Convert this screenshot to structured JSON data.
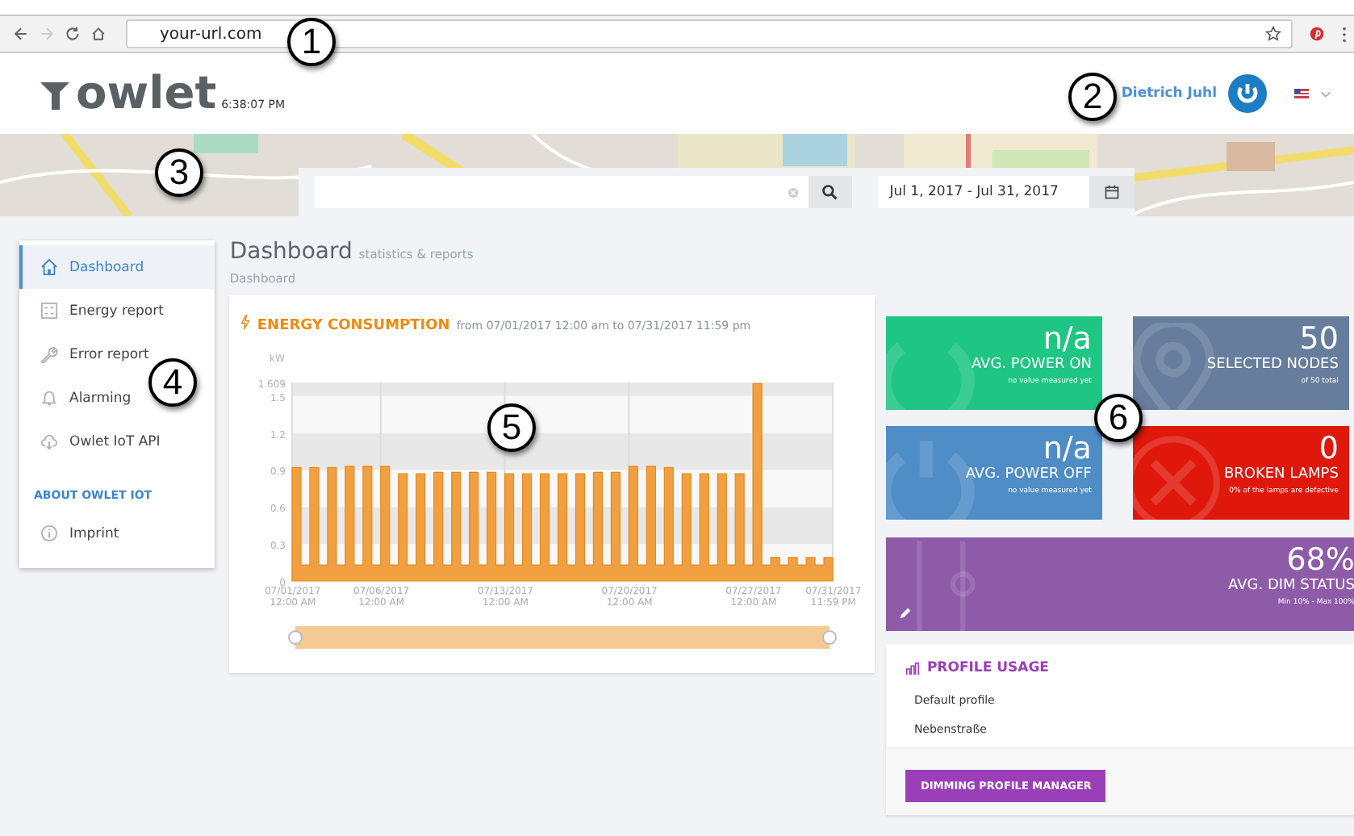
{
  "browser": {
    "url": "your-url.com"
  },
  "header": {
    "logo": "owlet",
    "time": "6:38:07 PM",
    "user": "Dietrich Juhl"
  },
  "search": {
    "date_range": "Jul 1, 2017 - Jul 31, 2017"
  },
  "sidebar": {
    "items": [
      {
        "label": "Dashboard",
        "kind": "home",
        "selected": true
      },
      {
        "label": "Energy report",
        "kind": "calculator",
        "selected": false
      },
      {
        "label": "Error report",
        "kind": "wrench",
        "selected": false
      },
      {
        "label": "Alarming",
        "kind": "bell",
        "selected": false
      },
      {
        "label": "Owlet IoT API",
        "kind": "cloud",
        "selected": false
      }
    ],
    "section": "ABOUT OWLET IOT",
    "footer_items": [
      {
        "label": "Imprint",
        "kind": "info",
        "selected": false
      }
    ]
  },
  "page": {
    "title": "Dashboard",
    "subtitle": "statistics & reports",
    "breadcrumb": "Dashboard"
  },
  "energy": {
    "title": "ENERGY CONSUMPTION",
    "range": "from 07/01/2017 12:00 am to 07/31/2017 11:59 pm",
    "chart_data": {
      "type": "area",
      "grid": true,
      "ylabel": "kW",
      "ylim": [
        0,
        1.609
      ],
      "categories": [
        "07/01/2017 12:00 AM",
        null,
        null,
        null,
        null,
        null,
        null,
        null,
        null,
        null,
        "07/06/2017 12:00 AM",
        null,
        null,
        null,
        null,
        null,
        null,
        null,
        null,
        null,
        null,
        null,
        null,
        null,
        "07/13/2017 12:00 AM",
        null,
        null,
        null,
        null,
        null,
        null,
        null,
        null,
        null,
        null,
        null,
        null,
        null,
        "07/20/2017 12:00 AM",
        null,
        null,
        null,
        null,
        null,
        null,
        null,
        null,
        null,
        null,
        null,
        null,
        null,
        "07/27/2017 12:00 AM",
        null,
        null,
        null,
        null,
        null,
        null,
        null,
        null,
        "07/31/2017 11:59 PM"
      ],
      "yticks": [
        0,
        0.3,
        0.6,
        0.9,
        1.2,
        1.5,
        {
          "value": 1.609,
          "label": "1.609"
        }
      ],
      "series": [
        {
          "color": "#f0a040",
          "values": [
            0.92,
            0.13,
            0.92,
            0.13,
            0.92,
            0.13,
            0.93,
            0.13,
            0.93,
            0.13,
            0.93,
            0.13,
            0.87,
            0.13,
            0.87,
            0.13,
            0.88,
            0.13,
            0.88,
            0.13,
            0.88,
            0.13,
            0.88,
            0.13,
            0.87,
            0.13,
            0.87,
            0.13,
            0.87,
            0.13,
            0.87,
            0.13,
            0.87,
            0.13,
            0.88,
            0.13,
            0.88,
            0.13,
            0.93,
            0.13,
            0.93,
            0.13,
            0.92,
            0.13,
            0.87,
            0.13,
            0.87,
            0.13,
            0.87,
            0.13,
            0.87,
            0.13,
            1.6,
            0.13,
            0.19,
            0.13,
            0.19,
            0.13,
            0.19,
            0.13,
            0.19,
            0.13
          ]
        }
      ]
    }
  },
  "tiles": [
    {
      "kind": "power_on",
      "value": "n/a",
      "label": "AVG. POWER ON",
      "note": "no value measured yet",
      "color": "#1ec583"
    },
    {
      "kind": "nodes",
      "value": "50",
      "label": "SELECTED NODES",
      "note": "of 50 total",
      "color": "#677d9d"
    },
    {
      "kind": "power_off",
      "value": "n/a",
      "label": "AVG. POWER OFF",
      "note": "no value measured yet",
      "color": "#4f8dc6"
    },
    {
      "kind": "broken",
      "value": "0",
      "label": "BROKEN LAMPS",
      "note": "0% of the lamps are defective",
      "color": "#e0180c"
    },
    {
      "kind": "dim",
      "value": "68%",
      "label": "AVG. DIM STATUS",
      "note": "Min 10% - Max 100%",
      "color": "#8e5ba8"
    }
  ],
  "profile_usage": {
    "title": "PROFILE USAGE",
    "items": [
      "Default profile",
      "Nebenstraße"
    ],
    "button": "DIMMING PROFILE MANAGER"
  },
  "callouts": [
    "1",
    "2",
    "3",
    "4",
    "5",
    "6"
  ]
}
